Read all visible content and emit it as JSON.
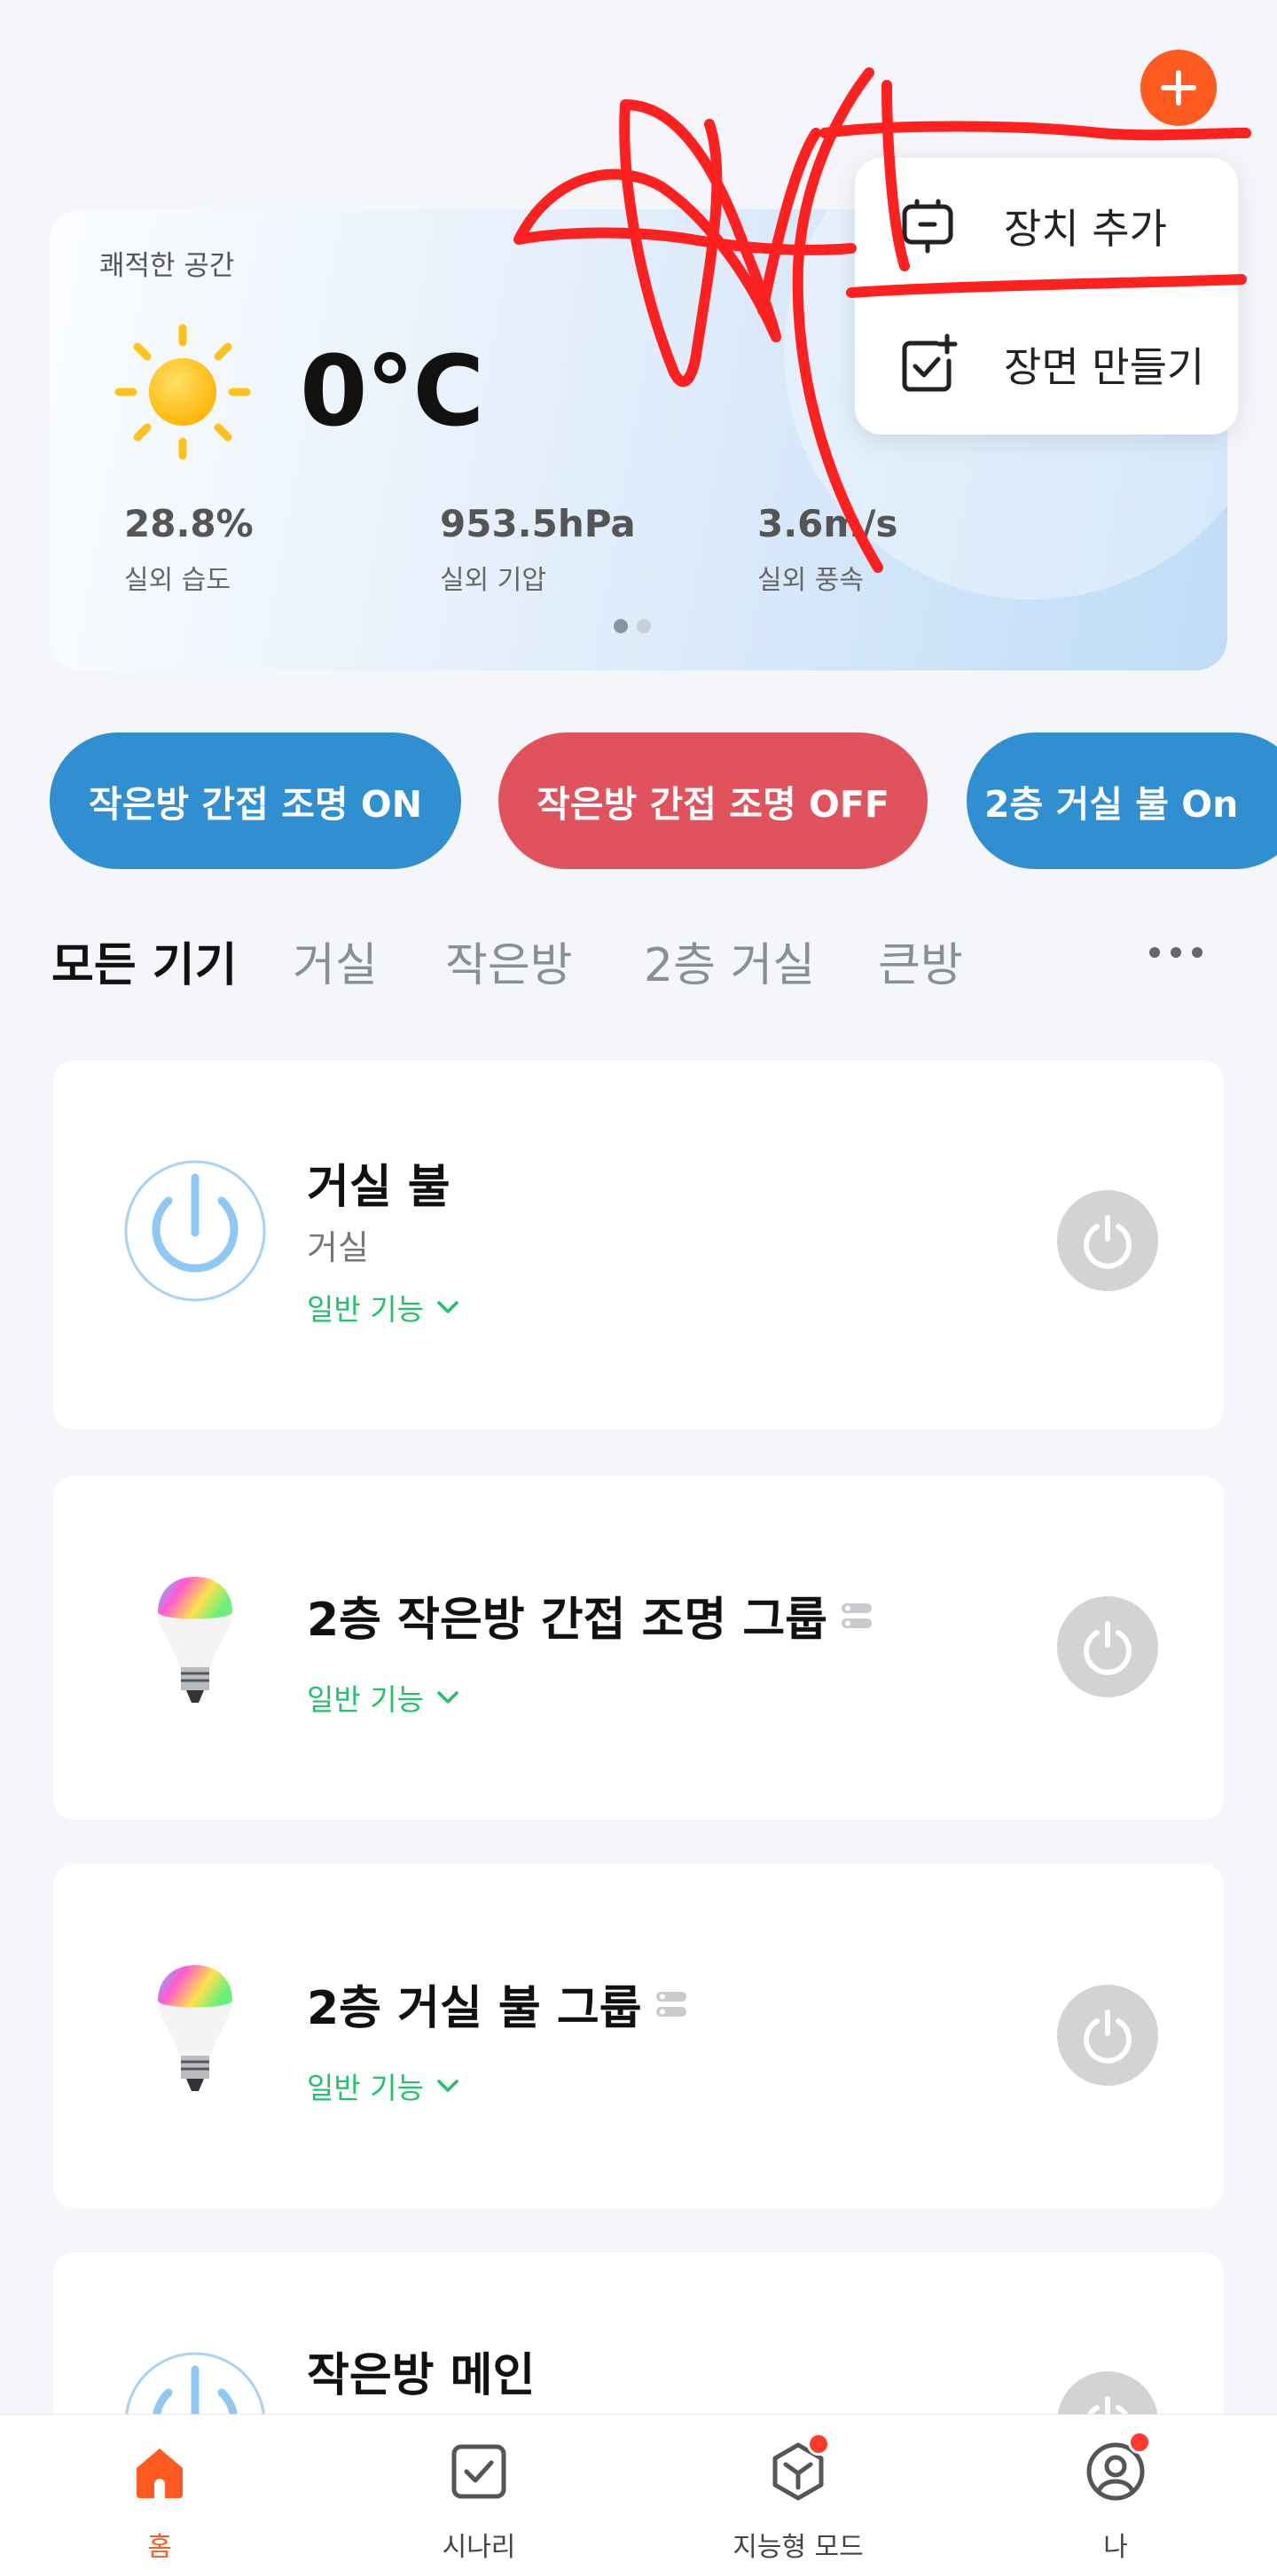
{
  "header": {
    "add_icon": "plus-icon",
    "accent": "#ff5a1f"
  },
  "weather": {
    "title": "쾌적한 공간",
    "icon": "sun-icon",
    "temperature": "0°C",
    "stats": [
      {
        "value": "28.8%",
        "label": "실외 습도"
      },
      {
        "value": "953.5hPa",
        "label": "실외 기압"
      },
      {
        "value": "3.6m/s",
        "label": "실외 풍속"
      }
    ],
    "page_dots": 2,
    "active_dot": 1
  },
  "menu": {
    "items": [
      {
        "label": "장치 추가",
        "icon": "device-add-icon"
      },
      {
        "label": "장면 만들기",
        "icon": "scene-create-icon"
      }
    ]
  },
  "scenes": [
    {
      "label": "작은방 간접 조명 ON",
      "color": "#2f8fd0"
    },
    {
      "label": "작은방 간접 조명 OFF",
      "color": "#e0525c"
    },
    {
      "label": "2층 거실 불 On",
      "color": "#2f8fd0"
    }
  ],
  "tabs": {
    "items": [
      "모든 기기",
      "거실",
      "작은방",
      "2층 거실",
      "큰방"
    ],
    "active": 0,
    "more_icon": "more-horizontal-icon"
  },
  "devices": [
    {
      "name": "거실 불",
      "room": "거실",
      "function": "일반 기능",
      "icon": "power-icon",
      "group": false
    },
    {
      "name": "2층 작은방 간접 조명 그룹",
      "room": "",
      "function": "일반 기능",
      "icon": "rgb-bulb-icon",
      "group": true
    },
    {
      "name": "2층 거실 불 그룹",
      "room": "",
      "function": "일반 기능",
      "icon": "rgb-bulb-icon",
      "group": true
    },
    {
      "name": "작은방 메인",
      "room": "",
      "function": "",
      "icon": "power-icon",
      "group": false
    }
  ],
  "bottom_nav": {
    "items": [
      {
        "label": "홈",
        "icon": "home-icon",
        "active": true,
        "badge": false
      },
      {
        "label": "시나리",
        "icon": "scenario-check-icon",
        "active": false,
        "badge": false
      },
      {
        "label": "지능형 모드",
        "icon": "smart-mode-icon",
        "active": false,
        "badge": true
      },
      {
        "label": "나",
        "icon": "profile-icon",
        "active": false,
        "badge": true
      }
    ]
  }
}
